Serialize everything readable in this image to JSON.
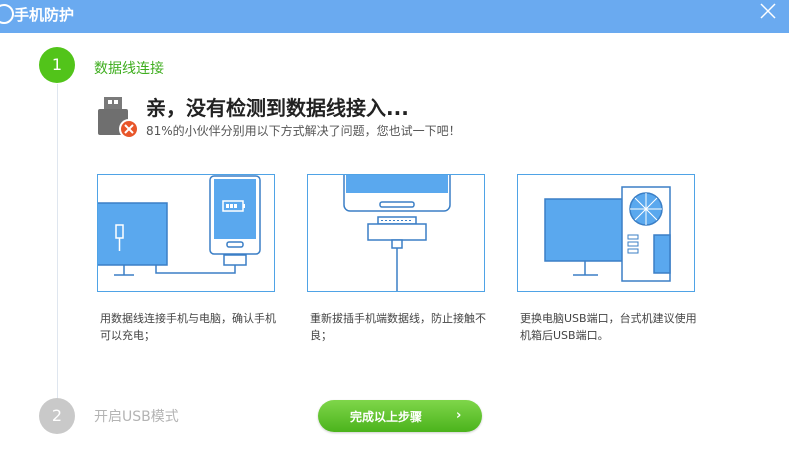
{
  "window": {
    "title": "手机防护"
  },
  "steps": [
    {
      "number": "1",
      "label": "数据线连接"
    },
    {
      "number": "2",
      "label": "开启USB模式"
    }
  ],
  "main": {
    "headline": "亲，没有检测到数据线接入...",
    "subline": "81%的小伙伴分别用以下方式解决了问题，您也试一下吧！"
  },
  "tips": [
    {
      "text": "用数据线连接手机与电脑，确认手机可以充电；"
    },
    {
      "text": "重新拔插手机端数据线，防止接触不良；"
    },
    {
      "text": "更换电脑USB端口，台式机建议使用机箱后USB端口。"
    }
  ],
  "actions": {
    "done_label": "完成以上步骤",
    "done_arrow": "›"
  },
  "colors": {
    "titlebar": "#6aaaf0",
    "accent_green": "#52c41a",
    "panel_border": "#4fa3e6",
    "screen_blue": "#5aa8ee"
  }
}
